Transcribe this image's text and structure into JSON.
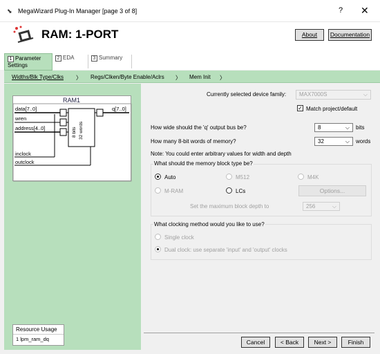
{
  "window": {
    "title": "MegaWizard Plug-In Manager [page 3 of 8]",
    "help_glyph": "?",
    "close_glyph": "✕"
  },
  "header": {
    "title": "RAM: 1-PORT",
    "about_label": "About",
    "documentation_label": "Documentation"
  },
  "tabs": [
    {
      "num": "1",
      "label": "Parameter Settings"
    },
    {
      "num": "2",
      "label": "EDA"
    },
    {
      "num": "3",
      "label": "Summary"
    }
  ],
  "breadcrumb": [
    "Widths/Blk Type/Clks",
    "Regs/Clken/Byte Enable/Aclrs",
    "Mem Init"
  ],
  "diagram": {
    "title": "RAM1",
    "inputs": [
      "data[7..0]",
      "wren",
      "address[4..0]",
      "inclock",
      "outclock"
    ],
    "output": "q[7..0]",
    "block_text": [
      "8 bits",
      "32 words"
    ]
  },
  "resource": {
    "title": "Resource Usage",
    "value": "1 lpm_ram_dq"
  },
  "device": {
    "label": "Currently selected device family:",
    "value": "MAX7000S",
    "match_label": "Match project/default"
  },
  "width": {
    "label": "How wide should the 'q' output bus be?",
    "value": "8",
    "unit": "bits"
  },
  "words": {
    "label": "How many 8-bit words of memory?",
    "value": "32",
    "unit": "words"
  },
  "note": "Note: You could enter arbitrary values for width and depth",
  "block_type": {
    "label": "What should the memory block type be?",
    "options": [
      "Auto",
      "M512",
      "M4K",
      "M-RAM",
      "LCs"
    ],
    "options_button": "Options...",
    "depth_label": "Set the maximum block depth to",
    "depth_value": "256"
  },
  "clocking": {
    "label": "What clocking method would you like to use?",
    "single": "Single clock",
    "dual": "Dual clock: use separate 'input' and 'output' clocks"
  },
  "footer": {
    "cancel": "Cancel",
    "back": "< Back",
    "next": "Next >",
    "finish": "Finish"
  }
}
